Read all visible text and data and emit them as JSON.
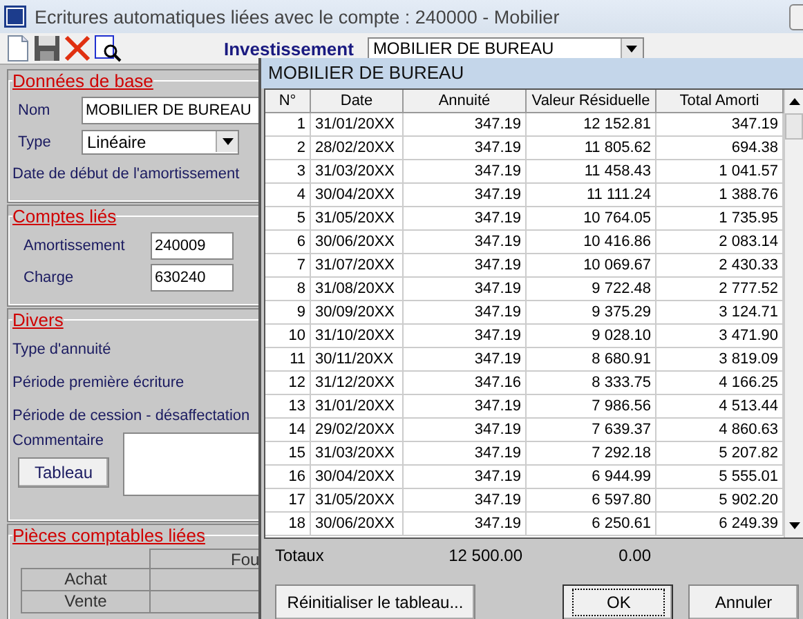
{
  "window": {
    "title": "Ecritures automatiques liées avec le compte : 240000 - Mobilier"
  },
  "investissement": {
    "label": "Investissement",
    "value": "MOBILIER DE BUREAU"
  },
  "donnees_de_base": {
    "title": "Données de base",
    "nom_label": "Nom",
    "nom_value": "MOBILIER DE BUREAU",
    "type_label": "Type",
    "type_value": "Linéaire",
    "date_label": "Date de début de l'amortissement"
  },
  "comptes_lies": {
    "title": "Comptes liés",
    "fields": [
      {
        "label": "Amortissement",
        "value": "240009"
      },
      {
        "label": "Charge",
        "value": "630240"
      }
    ]
  },
  "divers": {
    "title": "Divers",
    "labels": [
      "Type d'annuité",
      "Période première écriture",
      "Période de cession - désaffectation"
    ],
    "commentaire_label": "Commentaire",
    "tableau_button": "Tableau"
  },
  "pieces": {
    "title": "Pièces comptables liées",
    "column_2": "Fou",
    "rows": [
      "Achat",
      "Vente"
    ]
  },
  "popup": {
    "title": "MOBILIER DE BUREAU",
    "columns": [
      "N°",
      "Date",
      "Annuité",
      "Valeur Résiduelle",
      "Total Amorti"
    ],
    "rows": [
      [
        "1",
        "31/01/20XX",
        "347.19",
        "12 152.81",
        "347.19"
      ],
      [
        "2",
        "28/02/20XX",
        "347.19",
        "11 805.62",
        "694.38"
      ],
      [
        "3",
        "31/03/20XX",
        "347.19",
        "11 458.43",
        "1 041.57"
      ],
      [
        "4",
        "30/04/20XX",
        "347.19",
        "11 111.24",
        "1 388.76"
      ],
      [
        "5",
        "31/05/20XX",
        "347.19",
        "10 764.05",
        "1 735.95"
      ],
      [
        "6",
        "30/06/20XX",
        "347.19",
        "10 416.86",
        "2 083.14"
      ],
      [
        "7",
        "31/07/20XX",
        "347.19",
        "10 069.67",
        "2 430.33"
      ],
      [
        "8",
        "31/08/20XX",
        "347.19",
        "9 722.48",
        "2 777.52"
      ],
      [
        "9",
        "30/09/20XX",
        "347.19",
        "9 375.29",
        "3 124.71"
      ],
      [
        "10",
        "31/10/20XX",
        "347.19",
        "9 028.10",
        "3 471.90"
      ],
      [
        "11",
        "30/11/20XX",
        "347.19",
        "8 680.91",
        "3 819.09"
      ],
      [
        "12",
        "31/12/20XX",
        "347.16",
        "8 333.75",
        "4 166.25"
      ],
      [
        "13",
        "31/01/20XX",
        "347.19",
        "7 986.56",
        "4 513.44"
      ],
      [
        "14",
        "29/02/20XX",
        "347.19",
        "7 639.37",
        "4 860.63"
      ],
      [
        "15",
        "31/03/20XX",
        "347.19",
        "7 292.18",
        "5 207.82"
      ],
      [
        "16",
        "30/04/20XX",
        "347.19",
        "6 944.99",
        "5 555.01"
      ],
      [
        "17",
        "31/05/20XX",
        "347.19",
        "6 597.80",
        "5 902.20"
      ],
      [
        "18",
        "30/06/20XX",
        "347.19",
        "6 250.61",
        "6 249.39"
      ]
    ],
    "totals": {
      "label": "Totaux",
      "annuite": "12 500.00",
      "valeur": "0.00"
    },
    "buttons": [
      {
        "label": "Réinitialiser le tableau...",
        "focused": false
      },
      {
        "label": "OK",
        "focused": true
      },
      {
        "label": "Annuler",
        "focused": false
      }
    ]
  }
}
